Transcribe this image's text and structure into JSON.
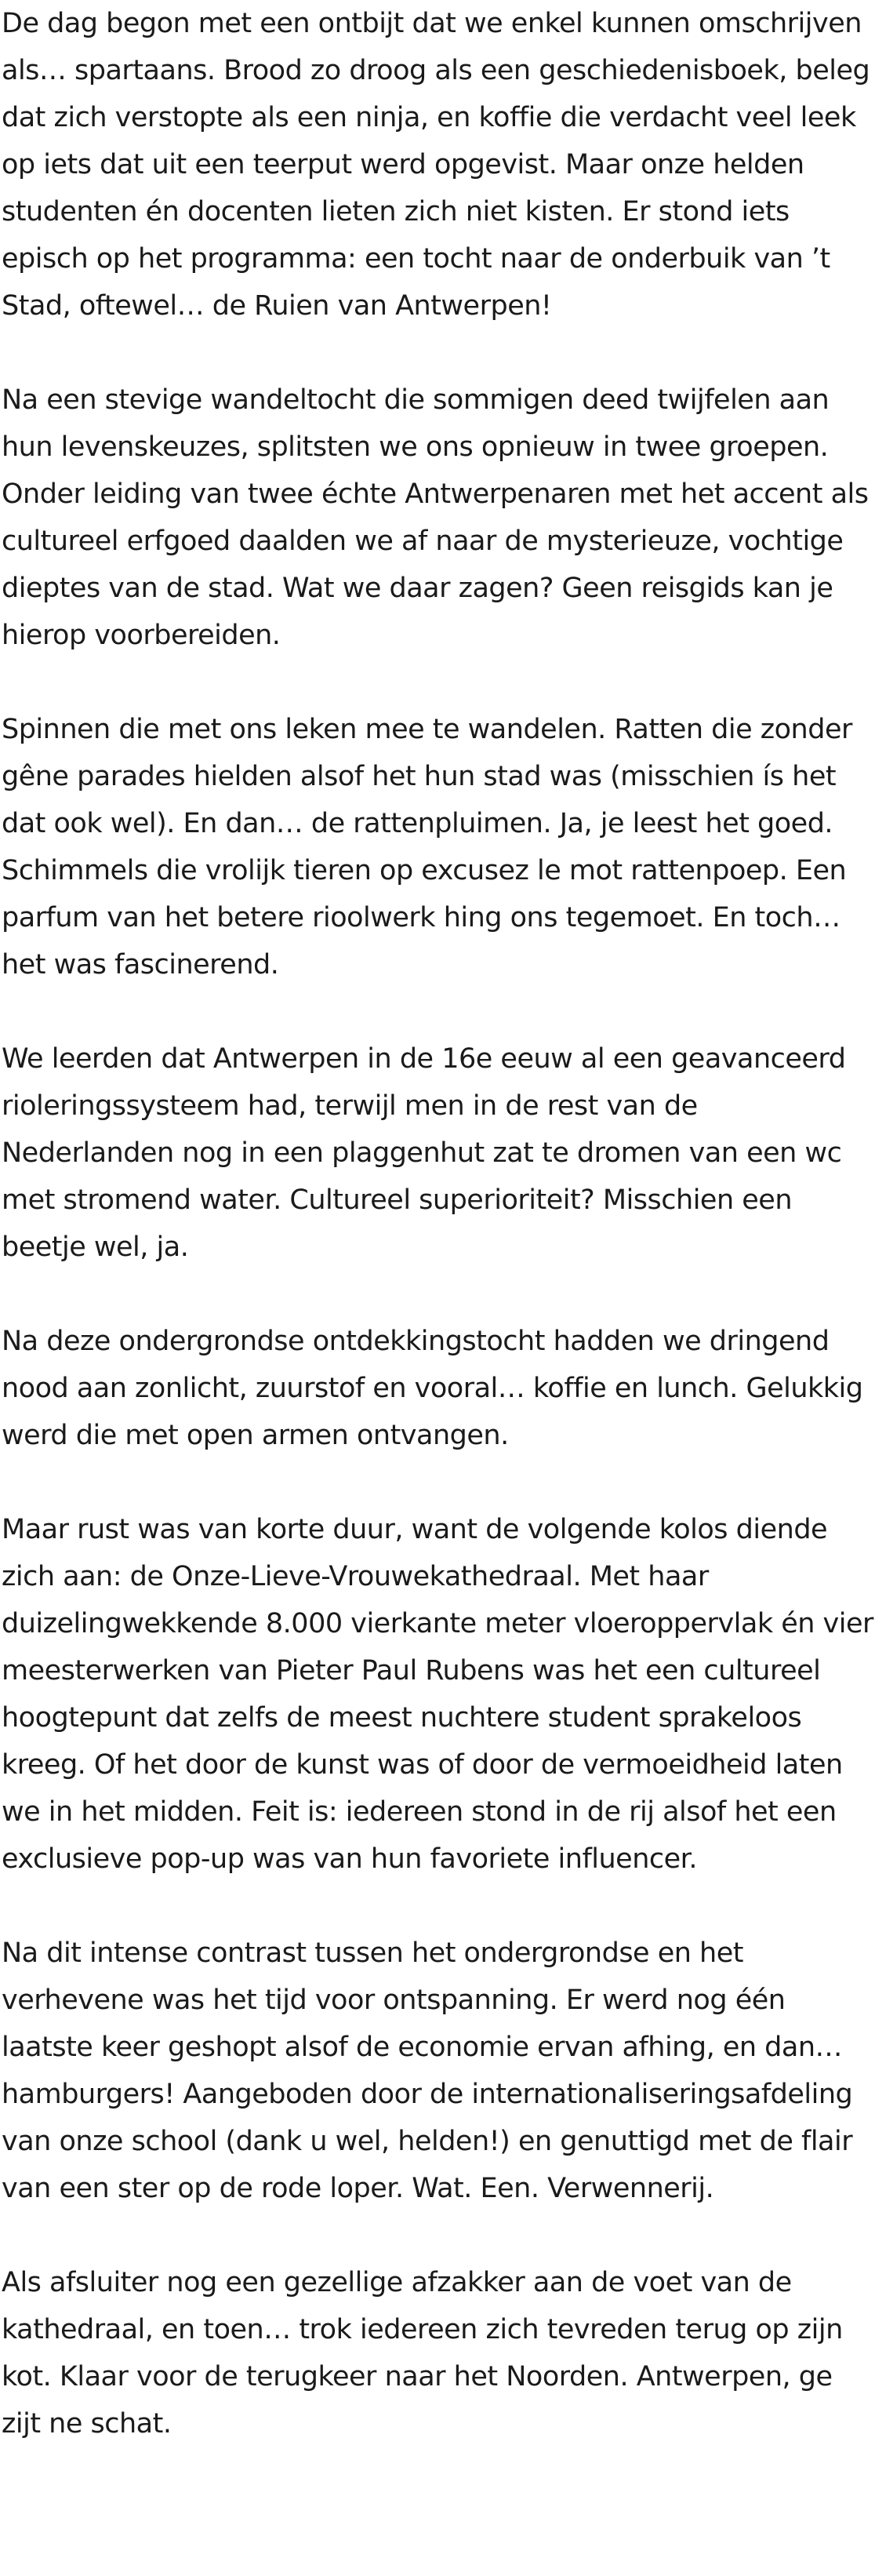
{
  "article": {
    "paragraphs": [
      "De dag begon met een ontbijt dat we enkel kunnen omschrijven als… spartaans. Brood zo droog als een geschiedenisboek, beleg dat zich verstopte als een ninja, en koffie die verdacht veel leek op iets dat uit een teerput werd opgevist. Maar onze helden studenten én docenten lieten zich niet kisten. Er stond iets episch op het programma: een tocht naar de onderbuik van ’t Stad, oftewel… de Ruien van Antwerpen!",
      "Na een stevige wandeltocht die sommigen deed twijfelen aan hun levenskeuzes, splitsten we ons opnieuw in twee groepen. Onder leiding van twee échte Antwerpenaren met het accent als cultureel erfgoed daalden we af naar de mysterieuze, vochtige dieptes van de stad. Wat we daar zagen? Geen reisgids kan je hierop voorbereiden.",
      "Spinnen die met ons leken mee te wandelen. Ratten die zonder gêne parades hielden alsof het hun stad was (misschien ís het dat ook wel). En dan… de rattenpluimen. Ja, je leest het goed. Schimmels die vrolijk tieren op excusez le mot rattenpoep. Een parfum van het betere rioolwerk hing ons tegemoet. En toch… het was fascinerend.",
      "We leerden dat Antwerpen in de 16e eeuw al een geavanceerd rioleringssysteem had, terwijl men in de rest van de Nederlanden nog in een plaggenhut zat te dromen van een wc met stromend water. Cultureel superioriteit? Misschien een beetje wel, ja.",
      "Na deze ondergrondse ontdekkingstocht hadden we dringend nood aan zonlicht, zuurstof en vooral… koffie en lunch. Gelukkig werd die met open armen ontvangen.",
      "Maar rust was van korte duur, want de volgende kolos diende zich aan: de Onze-Lieve-Vrouwekathedraal. Met haar duizelingwekkende 8.000 vierkante meter vloeroppervlak én vier meesterwerken van Pieter Paul Rubens was het een cultureel hoogtepunt dat zelfs de meest nuchtere student sprakeloos kreeg. Of het door de kunst was of door de vermoeidheid laten we in het midden. Feit is: iedereen stond in de rij alsof het een exclusieve pop-up was van hun favoriete influencer.",
      "Na dit intense contrast tussen het ondergrondse en het verhevene was het tijd voor ontspanning. Er werd nog één laatste keer geshopt alsof de economie ervan afhing, en dan… hamburgers! Aangeboden door de internationaliseringsafdeling van onze school (dank u wel, helden!) en genuttigd met de flair van een ster op de rode loper. Wat. Een. Verwennerij.",
      "Als afsluiter nog een gezellige afzakker aan de voet van de kathedraal, en toen… trok iedereen zich tevreden terug op zijn kot. Klaar voor de terugkeer naar het Noorden. Antwerpen, ge zijt ne schat."
    ]
  }
}
